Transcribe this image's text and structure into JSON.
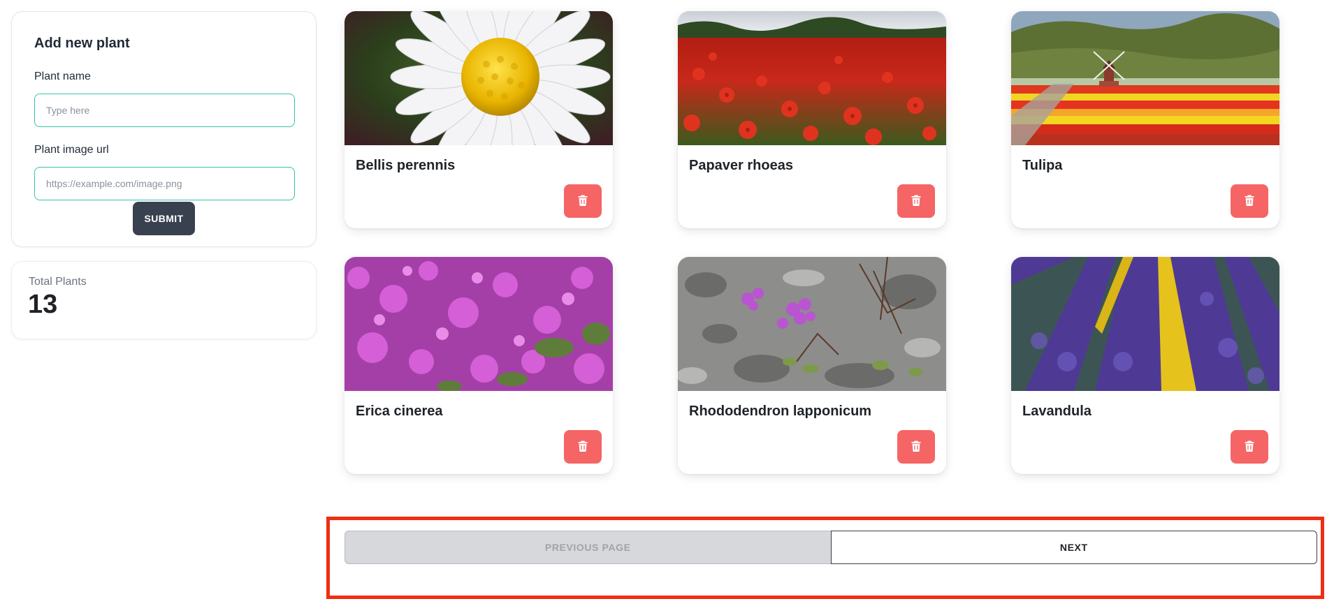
{
  "form": {
    "title": "Add new plant",
    "name_label": "Plant name",
    "name_placeholder": "Type here",
    "url_label": "Plant image url",
    "url_placeholder": "https://example.com/image.png",
    "submit_label": "SUBMIT"
  },
  "stats": {
    "title": "Total Plants",
    "value": "13"
  },
  "plants": [
    {
      "name": "Bellis perennis",
      "image": "daisy"
    },
    {
      "name": "Papaver rhoeas",
      "image": "poppy-field"
    },
    {
      "name": "Tulipa",
      "image": "tulip-field-windmill"
    },
    {
      "name": "Erica cinerea",
      "image": "heather"
    },
    {
      "name": "Rhododendron lapponicum",
      "image": "alpine-flowers"
    },
    {
      "name": "Lavandula",
      "image": "lavender-field"
    }
  ],
  "pagination": {
    "prev_label": "PREVIOUS PAGE",
    "next_label": "NEXT"
  },
  "colors": {
    "input_border": "#34c3a8",
    "submit_bg": "#394150",
    "delete_bg": "#f56565",
    "highlight": "#f02e12"
  },
  "icons": {
    "delete": "trash-icon"
  }
}
